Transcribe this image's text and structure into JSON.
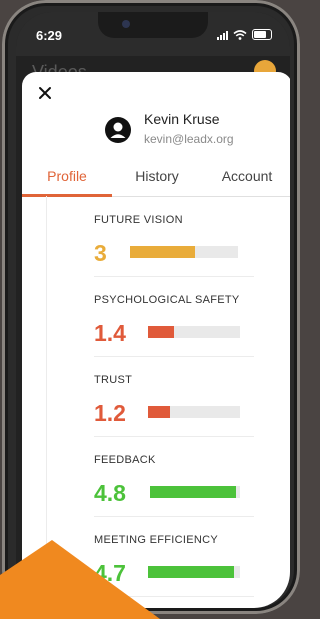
{
  "status_bar": {
    "time": "6:29"
  },
  "background_app": {
    "title": "Videos"
  },
  "user": {
    "name": "Kevin Kruse",
    "email": "kevin@leadx.org"
  },
  "tabs": [
    {
      "label": "Profile",
      "active": true
    },
    {
      "label": "History",
      "active": false
    },
    {
      "label": "Account",
      "active": false
    }
  ],
  "metrics": [
    {
      "label": "FUTURE VISION",
      "value": "3",
      "fill_fraction": 0.6,
      "color": "#e9ac3a"
    },
    {
      "label": "PSYCHOLOGICAL SAFETY",
      "value": "1.4",
      "fill_fraction": 0.28,
      "color": "#e05a3a"
    },
    {
      "label": "TRUST",
      "value": "1.2",
      "fill_fraction": 0.24,
      "color": "#e05a3a"
    },
    {
      "label": "FEEDBACK",
      "value": "4.8",
      "fill_fraction": 0.96,
      "color": "#4cc23a"
    },
    {
      "label": "MEETING EFFICIENCY",
      "value": "4.7",
      "fill_fraction": 0.94,
      "color": "#4cc23a"
    }
  ],
  "colors": {
    "accent": "#e06438",
    "brand_orange": "#f0891f"
  }
}
